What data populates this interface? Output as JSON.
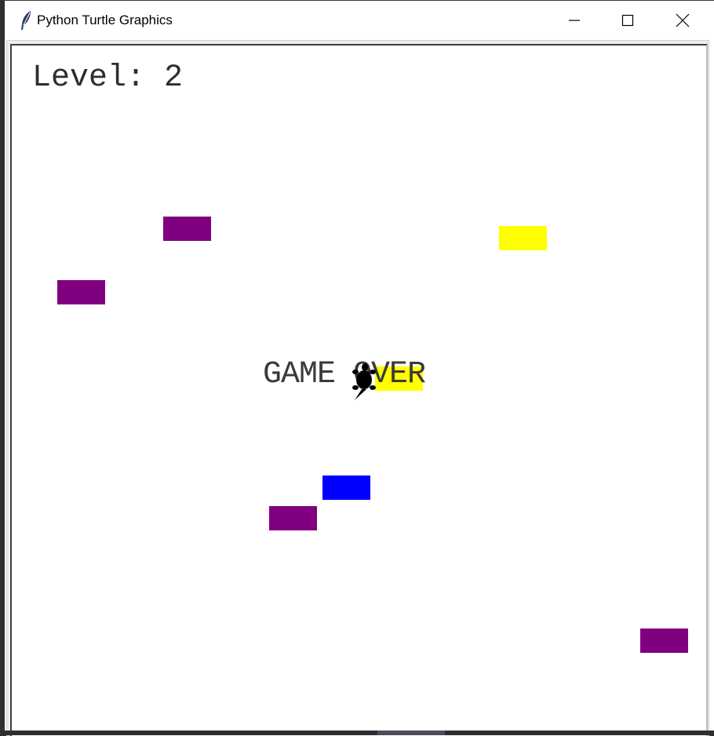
{
  "window": {
    "title": "Python Turtle Graphics"
  },
  "title_buttons": {
    "minimize": "minimize-icon",
    "maximize": "maximize-icon",
    "close": "close-icon"
  },
  "hud": {
    "level_text": "Level: 2"
  },
  "game": {
    "status_text": "GAME OVER",
    "player": "turtle-icon"
  },
  "colors": {
    "purple": "#800080",
    "yellow": "#ffff00",
    "blue": "#0000ff",
    "text": "#333333"
  },
  "cars": [
    {
      "color": "#800080"
    },
    {
      "color": "#ffff00"
    },
    {
      "color": "#800080"
    },
    {
      "color": "#ffff00"
    },
    {
      "color": "#0000ff"
    },
    {
      "color": "#800080"
    },
    {
      "color": "#800080"
    }
  ]
}
